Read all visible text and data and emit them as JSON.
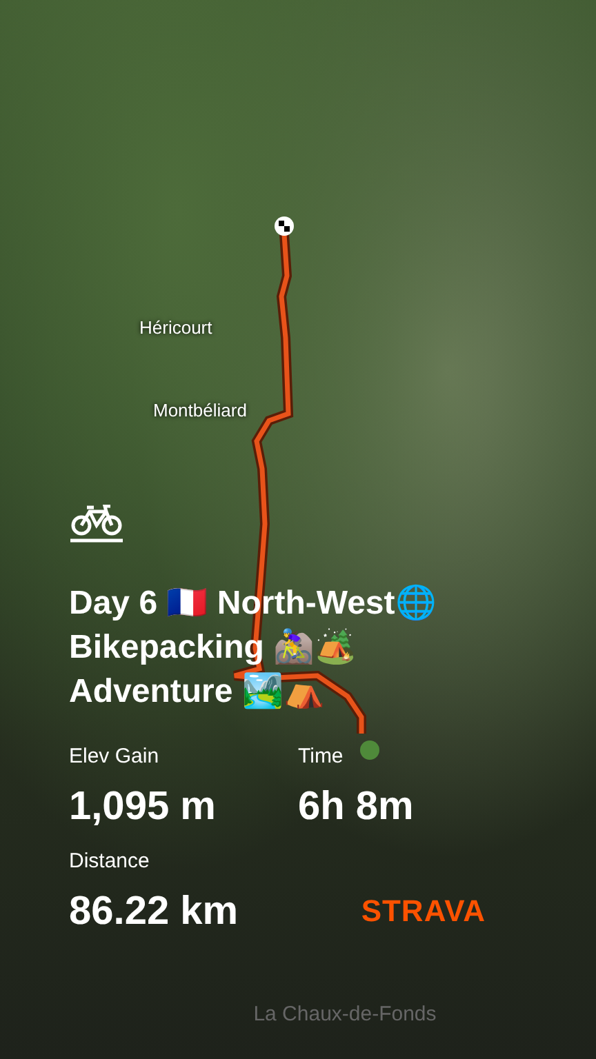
{
  "map": {
    "labels": [
      {
        "text": "Héricourt"
      },
      {
        "text": "Montbéliard"
      },
      {
        "text": "La Chaux-de-Fonds"
      }
    ]
  },
  "activity": {
    "title": "Day 6 🇫🇷 North-West🌐 Bikepacking 🚵‍♀️🏕️ Adventure 🏞️⛺",
    "stats": [
      {
        "label": "Elev Gain",
        "value": "1,095 m"
      },
      {
        "label": "Time",
        "value": "6h 8m"
      },
      {
        "label": "Distance",
        "value": "86.22 km"
      }
    ]
  },
  "brand": "STRAVA"
}
